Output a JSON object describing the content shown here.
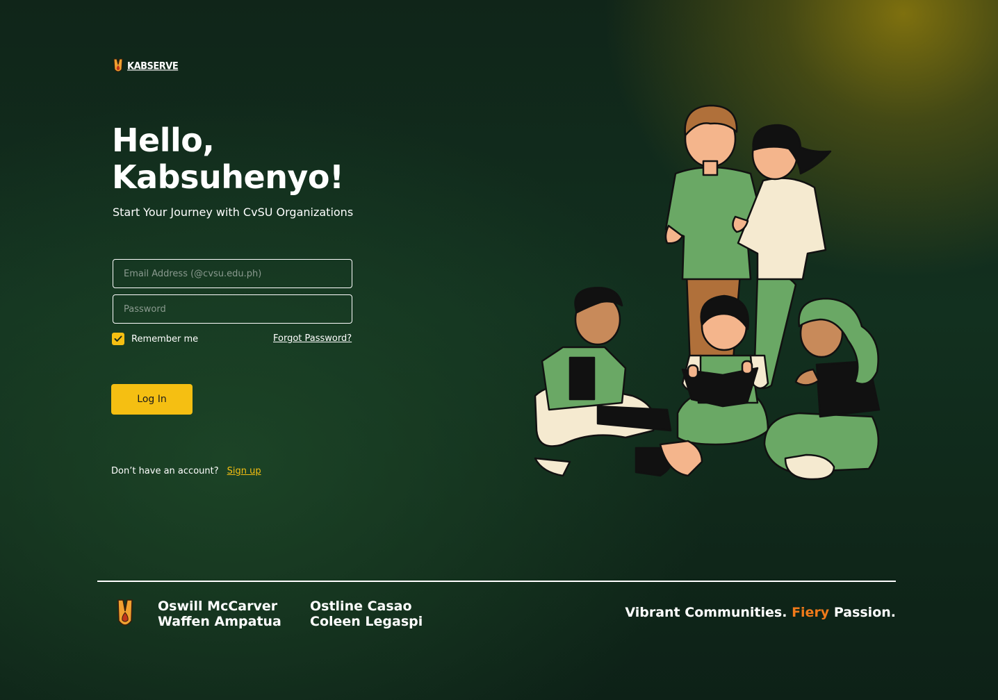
{
  "brand": {
    "name": "KABSERVE",
    "logo_icon": "torch-shield-icon"
  },
  "hero": {
    "title_line1": "Hello,",
    "title_line2": "Kabsuhenyo!",
    "subtitle": "Start Your Journey with CvSU Organizations"
  },
  "login_form": {
    "email_placeholder": "Email Address (@cvsu.edu.ph)",
    "email_value": "",
    "password_placeholder": "Password",
    "password_value": "",
    "remember_label": "Remember me",
    "remember_checked": true,
    "forgot_label": "Forgot Password?",
    "login_label": "Log In"
  },
  "signup": {
    "prompt": "Don’t have an account?",
    "link_label": "Sign up"
  },
  "footer": {
    "names_col1": [
      "Oswill McCarver",
      "Waffen Ampatua"
    ],
    "names_col2": [
      "Ostline Casao",
      "Coleen Legaspi"
    ],
    "tagline_part1": "Vibrant Communities.",
    "tagline_accent": "Fiery",
    "tagline_part2": "Passion."
  },
  "colors": {
    "accent_yellow": "#f5bf12",
    "accent_orange": "#f07a1a",
    "background_dark_green": "#12301f",
    "illustration_green": "#6aa865"
  }
}
